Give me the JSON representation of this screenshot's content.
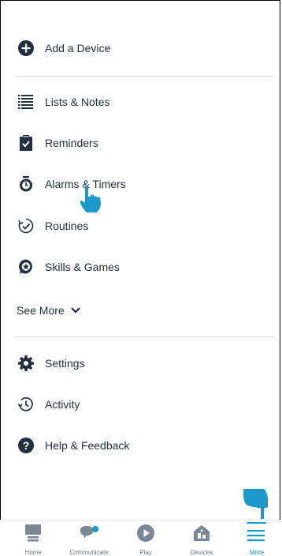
{
  "menu": {
    "items": [
      {
        "label": "Add a Device",
        "icon": "plus-circle-icon"
      },
      {
        "label": "Lists & Notes",
        "icon": "list-icon"
      },
      {
        "label": "Reminders",
        "icon": "clipboard-check-icon"
      },
      {
        "label": "Alarms & Timers",
        "icon": "alarm-clock-icon"
      },
      {
        "label": "Routines",
        "icon": "routines-icon"
      },
      {
        "label": "Skills & Games",
        "icon": "skills-icon"
      },
      {
        "label": "Settings",
        "icon": "gear-icon"
      },
      {
        "label": "Activity",
        "icon": "history-icon"
      },
      {
        "label": "Help & Feedback",
        "icon": "question-circle-icon"
      }
    ],
    "see_more": "See More"
  },
  "tabbar": {
    "tabs": [
      {
        "label": "Home",
        "icon": "home-icon"
      },
      {
        "label": "Communicate",
        "icon": "chat-icon"
      },
      {
        "label": "Play",
        "icon": "play-icon"
      },
      {
        "label": "Devices",
        "icon": "devices-icon"
      },
      {
        "label": "More",
        "icon": "menu-icon",
        "active": true
      }
    ]
  },
  "colors": {
    "text": "#232f3e",
    "accent": "#1a98c9",
    "tab_inactive": "#6f7a85",
    "divider": "#d6d9dc"
  }
}
